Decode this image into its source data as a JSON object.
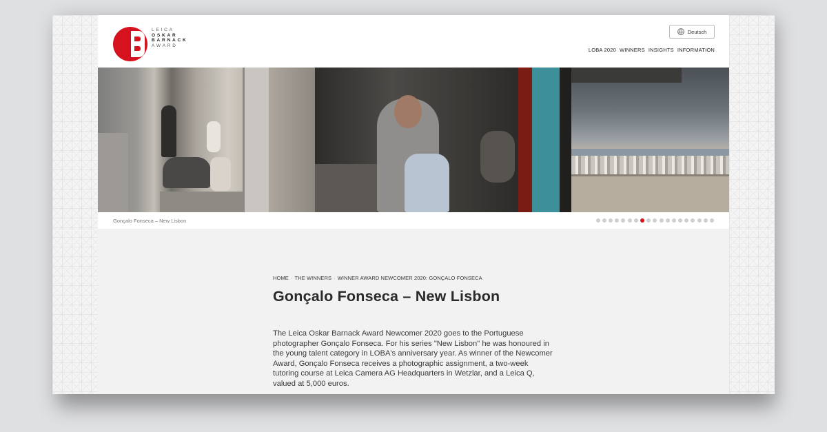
{
  "logo": {
    "lines": [
      "LEICA",
      "OSKAR",
      "BARNACK",
      "AWARD"
    ]
  },
  "header": {
    "language_label": "Deutsch",
    "nav": [
      "LOBA 2020",
      "WINNERS",
      "INSIGHTS",
      "INFORMATION"
    ]
  },
  "slider": {
    "caption": "Gonçalo Fonseca – New Lisbon",
    "dot_count": 19,
    "active_index": 7
  },
  "breadcrumb": [
    "HOME",
    "THE WINNERS",
    "WINNER AWARD NEWCOMER 2020: GONÇALO FONSECA"
  ],
  "article": {
    "title": "Gonçalo Fonseca – New Lisbon",
    "body": "The Leica Oskar Barnack Award Newcomer 2020 goes to the Portuguese photographer Gonçalo Fonseca. For his series \"New Lisbon\" he was honoured in the young talent category in LOBA's anniversary year. As winner of the Newcomer Award, Gonçalo Fonseca receives a photographic assignment, a two-week tutoring course at Leica Camera AG Headquarters in Wetzlar, and a Leica Q, valued at 5,000 euros."
  },
  "colors": {
    "brand_red": "#d7121f",
    "background": "#f2f2f2"
  }
}
